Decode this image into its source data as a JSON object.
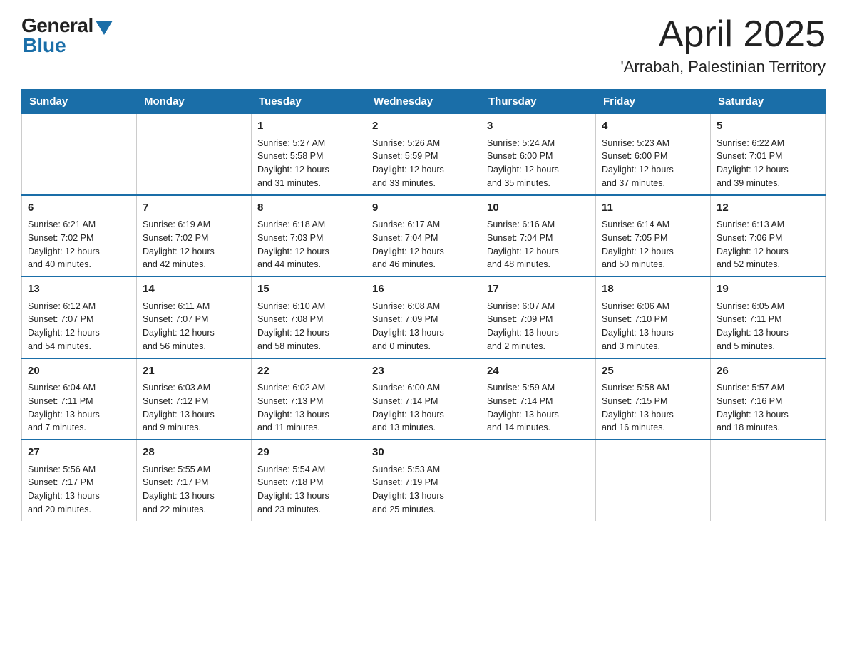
{
  "header": {
    "logo_general": "General",
    "logo_blue": "Blue",
    "month_title": "April 2025",
    "subtitle": "'Arrabah, Palestinian Territory"
  },
  "weekdays": [
    "Sunday",
    "Monday",
    "Tuesday",
    "Wednesday",
    "Thursday",
    "Friday",
    "Saturday"
  ],
  "weeks": [
    [
      {
        "day": "",
        "info": ""
      },
      {
        "day": "",
        "info": ""
      },
      {
        "day": "1",
        "info": "Sunrise: 5:27 AM\nSunset: 5:58 PM\nDaylight: 12 hours\nand 31 minutes."
      },
      {
        "day": "2",
        "info": "Sunrise: 5:26 AM\nSunset: 5:59 PM\nDaylight: 12 hours\nand 33 minutes."
      },
      {
        "day": "3",
        "info": "Sunrise: 5:24 AM\nSunset: 6:00 PM\nDaylight: 12 hours\nand 35 minutes."
      },
      {
        "day": "4",
        "info": "Sunrise: 5:23 AM\nSunset: 6:00 PM\nDaylight: 12 hours\nand 37 minutes."
      },
      {
        "day": "5",
        "info": "Sunrise: 6:22 AM\nSunset: 7:01 PM\nDaylight: 12 hours\nand 39 minutes."
      }
    ],
    [
      {
        "day": "6",
        "info": "Sunrise: 6:21 AM\nSunset: 7:02 PM\nDaylight: 12 hours\nand 40 minutes."
      },
      {
        "day": "7",
        "info": "Sunrise: 6:19 AM\nSunset: 7:02 PM\nDaylight: 12 hours\nand 42 minutes."
      },
      {
        "day": "8",
        "info": "Sunrise: 6:18 AM\nSunset: 7:03 PM\nDaylight: 12 hours\nand 44 minutes."
      },
      {
        "day": "9",
        "info": "Sunrise: 6:17 AM\nSunset: 7:04 PM\nDaylight: 12 hours\nand 46 minutes."
      },
      {
        "day": "10",
        "info": "Sunrise: 6:16 AM\nSunset: 7:04 PM\nDaylight: 12 hours\nand 48 minutes."
      },
      {
        "day": "11",
        "info": "Sunrise: 6:14 AM\nSunset: 7:05 PM\nDaylight: 12 hours\nand 50 minutes."
      },
      {
        "day": "12",
        "info": "Sunrise: 6:13 AM\nSunset: 7:06 PM\nDaylight: 12 hours\nand 52 minutes."
      }
    ],
    [
      {
        "day": "13",
        "info": "Sunrise: 6:12 AM\nSunset: 7:07 PM\nDaylight: 12 hours\nand 54 minutes."
      },
      {
        "day": "14",
        "info": "Sunrise: 6:11 AM\nSunset: 7:07 PM\nDaylight: 12 hours\nand 56 minutes."
      },
      {
        "day": "15",
        "info": "Sunrise: 6:10 AM\nSunset: 7:08 PM\nDaylight: 12 hours\nand 58 minutes."
      },
      {
        "day": "16",
        "info": "Sunrise: 6:08 AM\nSunset: 7:09 PM\nDaylight: 13 hours\nand 0 minutes."
      },
      {
        "day": "17",
        "info": "Sunrise: 6:07 AM\nSunset: 7:09 PM\nDaylight: 13 hours\nand 2 minutes."
      },
      {
        "day": "18",
        "info": "Sunrise: 6:06 AM\nSunset: 7:10 PM\nDaylight: 13 hours\nand 3 minutes."
      },
      {
        "day": "19",
        "info": "Sunrise: 6:05 AM\nSunset: 7:11 PM\nDaylight: 13 hours\nand 5 minutes."
      }
    ],
    [
      {
        "day": "20",
        "info": "Sunrise: 6:04 AM\nSunset: 7:11 PM\nDaylight: 13 hours\nand 7 minutes."
      },
      {
        "day": "21",
        "info": "Sunrise: 6:03 AM\nSunset: 7:12 PM\nDaylight: 13 hours\nand 9 minutes."
      },
      {
        "day": "22",
        "info": "Sunrise: 6:02 AM\nSunset: 7:13 PM\nDaylight: 13 hours\nand 11 minutes."
      },
      {
        "day": "23",
        "info": "Sunrise: 6:00 AM\nSunset: 7:14 PM\nDaylight: 13 hours\nand 13 minutes."
      },
      {
        "day": "24",
        "info": "Sunrise: 5:59 AM\nSunset: 7:14 PM\nDaylight: 13 hours\nand 14 minutes."
      },
      {
        "day": "25",
        "info": "Sunrise: 5:58 AM\nSunset: 7:15 PM\nDaylight: 13 hours\nand 16 minutes."
      },
      {
        "day": "26",
        "info": "Sunrise: 5:57 AM\nSunset: 7:16 PM\nDaylight: 13 hours\nand 18 minutes."
      }
    ],
    [
      {
        "day": "27",
        "info": "Sunrise: 5:56 AM\nSunset: 7:17 PM\nDaylight: 13 hours\nand 20 minutes."
      },
      {
        "day": "28",
        "info": "Sunrise: 5:55 AM\nSunset: 7:17 PM\nDaylight: 13 hours\nand 22 minutes."
      },
      {
        "day": "29",
        "info": "Sunrise: 5:54 AM\nSunset: 7:18 PM\nDaylight: 13 hours\nand 23 minutes."
      },
      {
        "day": "30",
        "info": "Sunrise: 5:53 AM\nSunset: 7:19 PM\nDaylight: 13 hours\nand 25 minutes."
      },
      {
        "day": "",
        "info": ""
      },
      {
        "day": "",
        "info": ""
      },
      {
        "day": "",
        "info": ""
      }
    ]
  ]
}
